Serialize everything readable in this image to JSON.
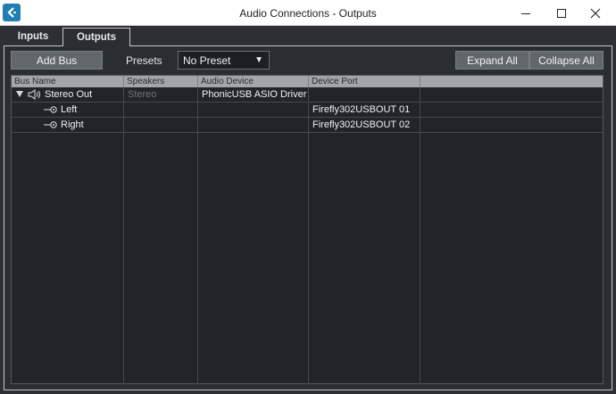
{
  "window": {
    "title": "Audio Connections - Outputs",
    "app_icon": "cubase-logo-icon",
    "controls": [
      "minimize-icon",
      "maximize-icon",
      "close-icon"
    ]
  },
  "tabs": [
    {
      "label": "Inputs",
      "active": false
    },
    {
      "label": "Outputs",
      "active": true
    }
  ],
  "toolbar": {
    "add_bus_label": "Add Bus",
    "presets_label": "Presets",
    "preset_value": "No Preset",
    "expand_all_label": "Expand All",
    "collapse_all_label": "Collapse All"
  },
  "table": {
    "columns": [
      "Bus Name",
      "Speakers",
      "Audio Device",
      "Device Port"
    ],
    "rows": [
      {
        "name": "Stereo Out",
        "speakers": "Stereo",
        "device": "PhonicUSB ASIO Driver",
        "port": "",
        "type": "bus",
        "expanded": true,
        "icon": "speaker-icon"
      },
      {
        "name": "Left",
        "speakers": "",
        "device": "",
        "port": "Firefly302USBOUT 01",
        "type": "channel",
        "icon": "output-channel-icon"
      },
      {
        "name": "Right",
        "speakers": "",
        "device": "",
        "port": "Firefly302USBOUT 02",
        "type": "channel",
        "icon": "output-channel-icon"
      }
    ]
  },
  "colors": {
    "background": "#2c2f33",
    "button": "#62676c",
    "header": "#a2a6aa",
    "app_icon": "#1e7fb0"
  }
}
